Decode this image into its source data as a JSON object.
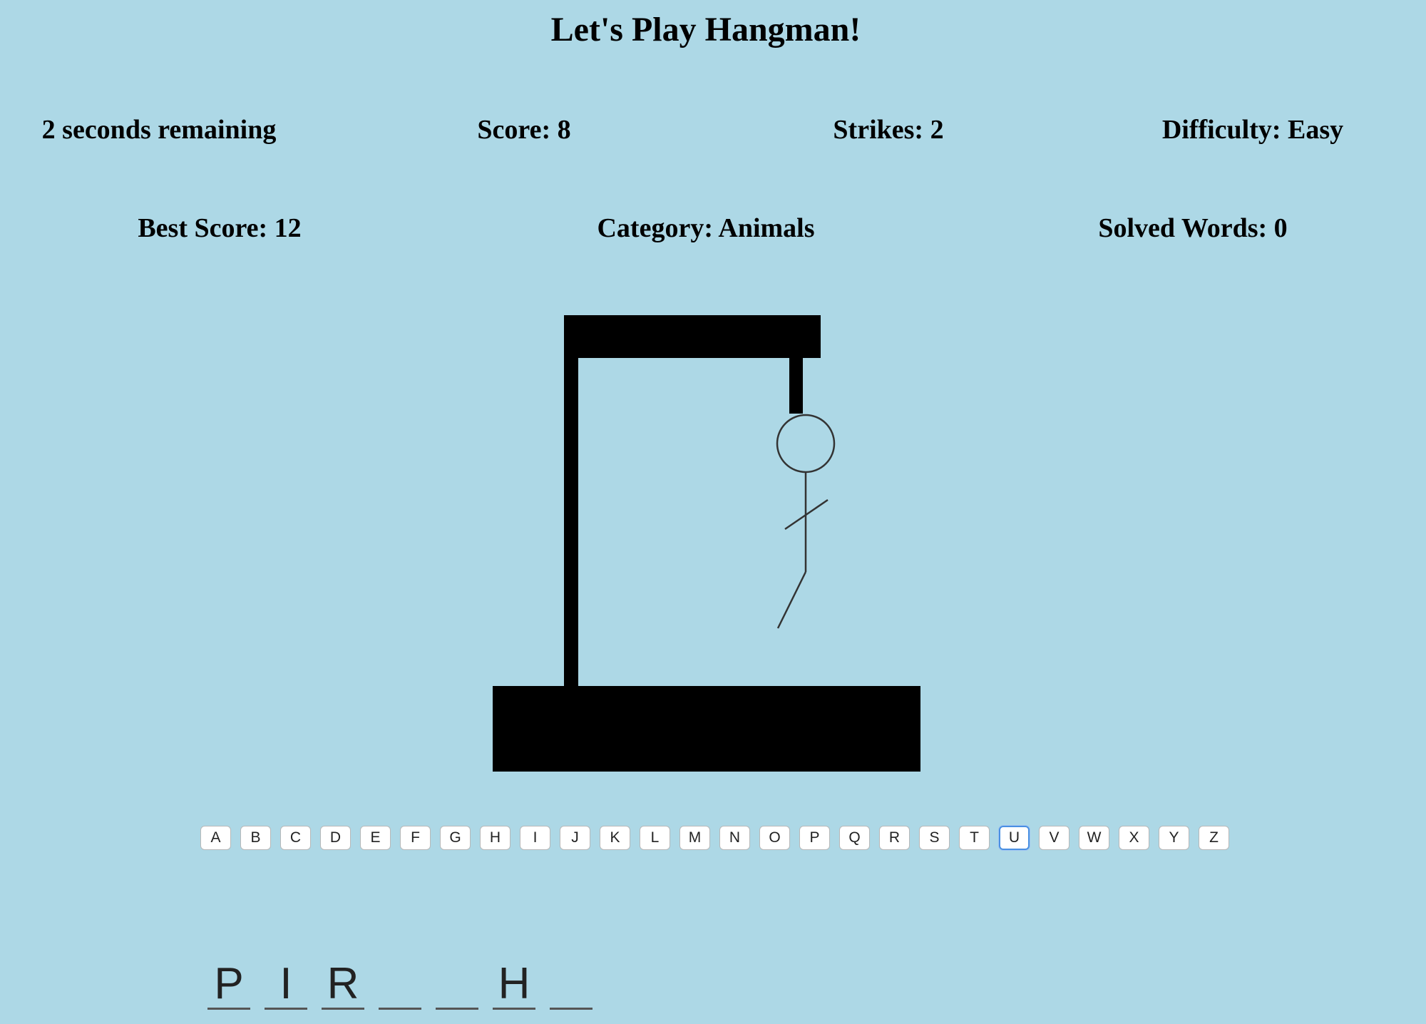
{
  "title": "Let's Play Hangman!",
  "stats": {
    "timer": "2 seconds remaining",
    "score": "Score: 8",
    "strikes": "Strikes: 2",
    "difficulty": "Difficulty: Easy",
    "best_score": "Best Score: 12",
    "category": "Category: Animals",
    "solved_words": "Solved Words: 0"
  },
  "game": {
    "strike_count": 2,
    "hangman_parts_visible": [
      "head",
      "body",
      "arm",
      "leg"
    ]
  },
  "keyboard": {
    "letters": [
      "A",
      "B",
      "C",
      "D",
      "E",
      "F",
      "G",
      "H",
      "I",
      "J",
      "K",
      "L",
      "M",
      "N",
      "O",
      "P",
      "Q",
      "R",
      "S",
      "T",
      "U",
      "V",
      "W",
      "X",
      "Y",
      "Z"
    ],
    "focused": "U"
  },
  "word": {
    "slots": [
      "P",
      "I",
      "R",
      "",
      "",
      "H",
      ""
    ]
  },
  "colors": {
    "background": "#add8e6",
    "gallows": "#000000",
    "figure": "#333333",
    "focus_ring": "#4a90e2"
  }
}
